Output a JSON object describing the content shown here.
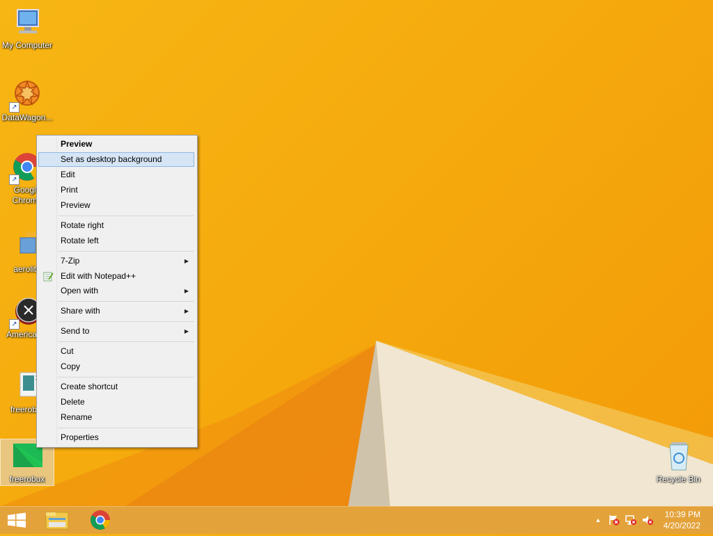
{
  "desktop_icons": [
    {
      "label": "My Computer"
    },
    {
      "label": "DataWagon..."
    },
    {
      "label": "Google Chrome"
    },
    {
      "label": "aerolite"
    },
    {
      "label": "Americas..."
    },
    {
      "label": "freerob..."
    },
    {
      "label": "freerobux"
    },
    {
      "label": "Recycle Bin"
    }
  ],
  "context_menu": {
    "items": [
      {
        "label": "Preview"
      },
      {
        "label": "Set as desktop background"
      },
      {
        "label": "Edit"
      },
      {
        "label": "Print"
      },
      {
        "label": "Preview"
      },
      {
        "label": "Rotate right"
      },
      {
        "label": "Rotate left"
      },
      {
        "label": "7-Zip"
      },
      {
        "label": "Edit with Notepad++"
      },
      {
        "label": "Open with"
      },
      {
        "label": "Share with"
      },
      {
        "label": "Send to"
      },
      {
        "label": "Cut"
      },
      {
        "label": "Copy"
      },
      {
        "label": "Create shortcut"
      },
      {
        "label": "Delete"
      },
      {
        "label": "Rename"
      },
      {
        "label": "Properties"
      }
    ]
  },
  "taskbar": {
    "clock": {
      "time": "10:39 PM",
      "date": "4/20/2022"
    }
  },
  "colors": {
    "wallpaper": "#f5aa0d",
    "menu_highlight": "#d5e5f5",
    "taskbar": "#e4a23a"
  }
}
